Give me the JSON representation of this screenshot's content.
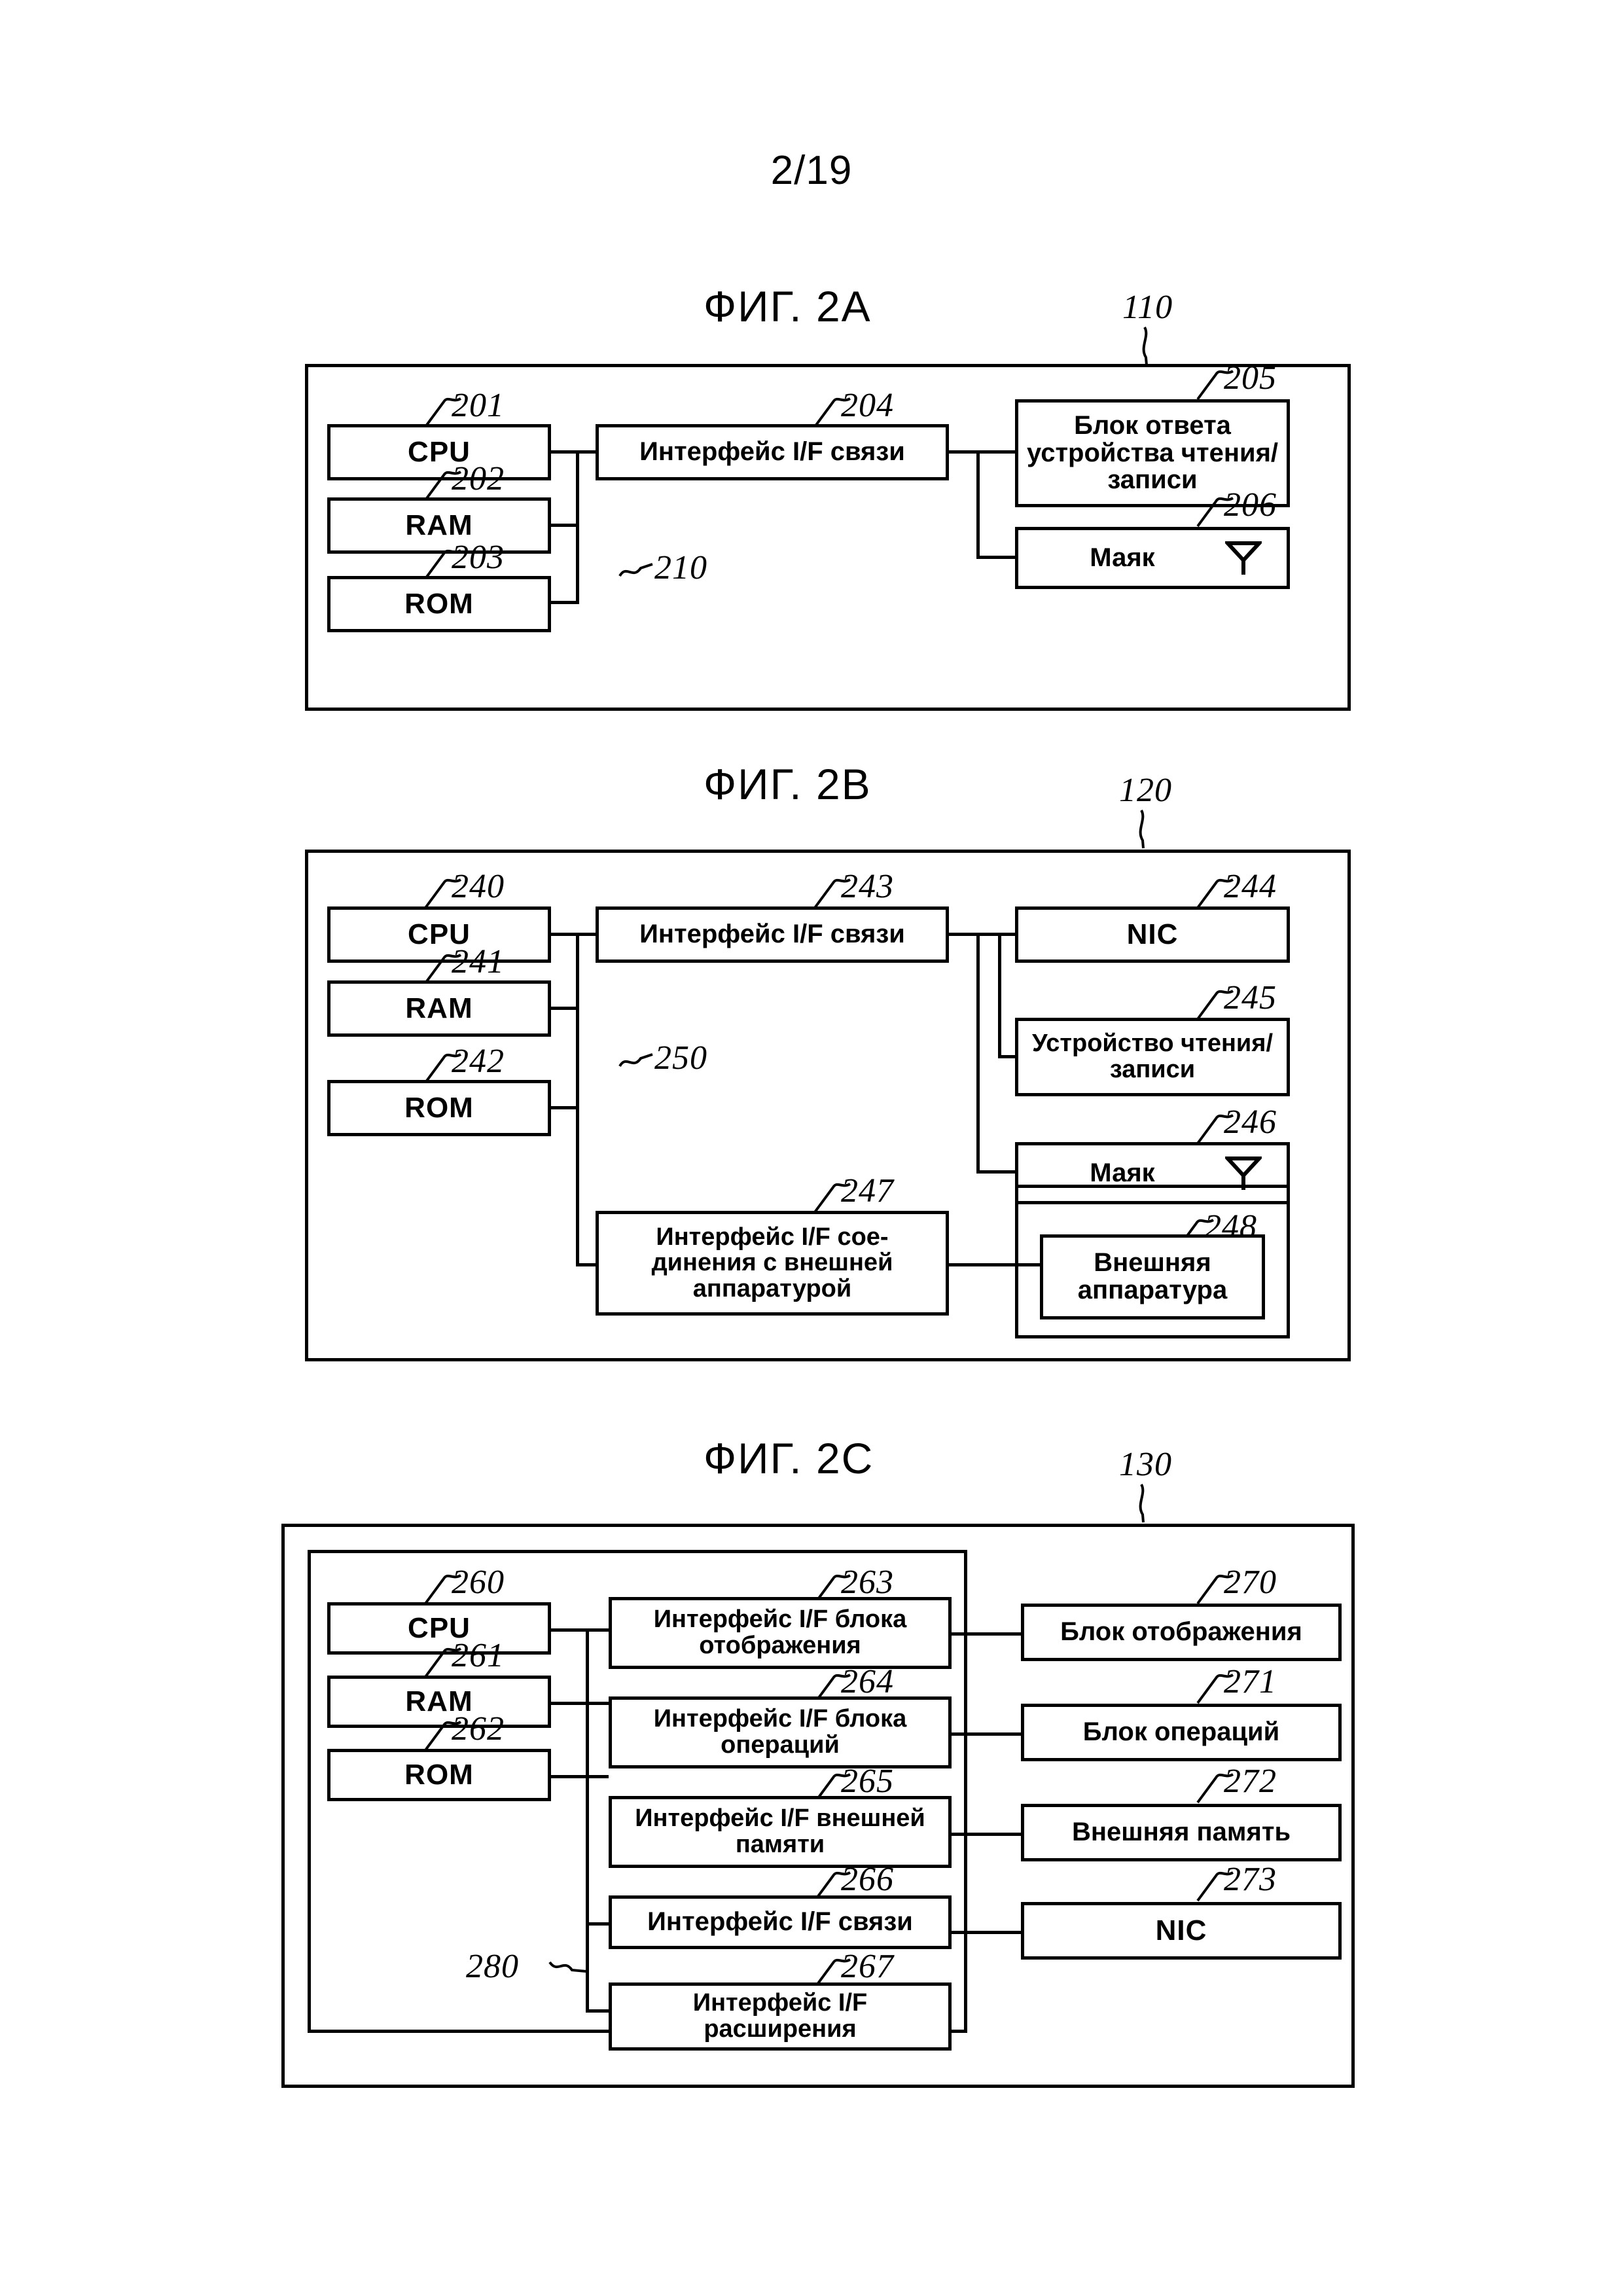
{
  "page": {
    "number": "2/19"
  },
  "figures": [
    {
      "id": "fig-2a",
      "title": "ФИГ. 2A",
      "frame_ref": "110",
      "bus_ref": "210",
      "blocks": [
        {
          "ref": "201",
          "label": "CPU"
        },
        {
          "ref": "202",
          "label": "RAM"
        },
        {
          "ref": "203",
          "label": "ROM"
        },
        {
          "ref": "204",
          "label": "Интерфейс I/F связи"
        },
        {
          "ref": "205",
          "label": "Блок ответа устройства чтения/ записи"
        },
        {
          "ref": "206",
          "label": "Маяк",
          "icon": "antenna-icon"
        }
      ]
    },
    {
      "id": "fig-2b",
      "title": "ФИГ. 2B",
      "frame_ref": "120",
      "bus_ref": "250",
      "blocks": [
        {
          "ref": "240",
          "label": "CPU"
        },
        {
          "ref": "241",
          "label": "RAM"
        },
        {
          "ref": "242",
          "label": "ROM"
        },
        {
          "ref": "243",
          "label": "Интерфейс I/F связи"
        },
        {
          "ref": "244",
          "label": "NIC"
        },
        {
          "ref": "245",
          "label": "Устройство чтения/ записи"
        },
        {
          "ref": "246",
          "label": "Маяк",
          "icon": "antenna-icon"
        },
        {
          "ref": "247",
          "label": "Интерфейс I/F сое-динения с внешней аппаратурой"
        },
        {
          "ref": "248",
          "label": "Внешняя аппаратура"
        }
      ]
    },
    {
      "id": "fig-2c",
      "title": "ФИГ. 2C",
      "frame_ref": "130",
      "bus_ref": "280",
      "blocks": [
        {
          "ref": "260",
          "label": "CPU"
        },
        {
          "ref": "261",
          "label": "RAM"
        },
        {
          "ref": "262",
          "label": "ROM"
        },
        {
          "ref": "263",
          "label": "Интерфейс I/F  блока отображения"
        },
        {
          "ref": "264",
          "label": "Интерфейс I/F блока операций"
        },
        {
          "ref": "265",
          "label": "Интерфейс I/F внешней памяти"
        },
        {
          "ref": "266",
          "label": "Интерфейс I/F связи"
        },
        {
          "ref": "267",
          "label": "Интерфейс I/F расширения"
        },
        {
          "ref": "270",
          "label": "Блок отображения"
        },
        {
          "ref": "271",
          "label": "Блок операций"
        },
        {
          "ref": "272",
          "label": "Внешняя память"
        },
        {
          "ref": "273",
          "label": "NIC"
        }
      ]
    }
  ]
}
